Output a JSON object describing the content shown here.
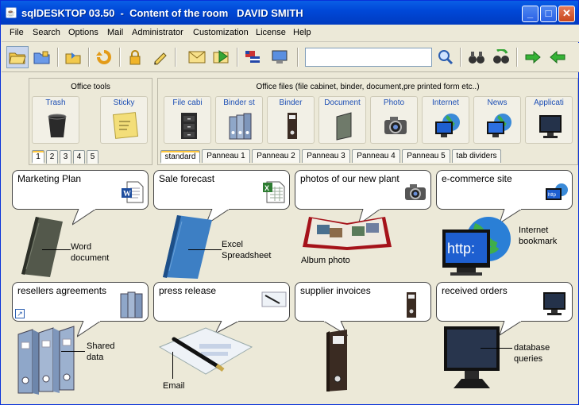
{
  "window": {
    "title": "sqlDESKTOP 03.50  -  Content of the room   DAVID SMITH",
    "min_glyph": "_",
    "max_glyph": "□",
    "close_glyph": "✕"
  },
  "menu": [
    "File",
    "Search",
    "Options",
    "Mail",
    "Administrator",
    "Customization",
    "License",
    "Help"
  ],
  "search": {
    "value": ""
  },
  "office_tools": {
    "title": "Office tools",
    "items": [
      {
        "label": "Trash",
        "icon": "trash-icon"
      },
      {
        "label": "Sticky",
        "icon": "sticky-note-icon"
      }
    ],
    "pages": [
      "1",
      "2",
      "3",
      "4",
      "5"
    ],
    "selected_page": "1"
  },
  "office_files": {
    "title": "Office files (file cabinet, binder, document,pre printed form etc..)",
    "items": [
      {
        "label": "File cabi",
        "icon": "file-cabinet-icon"
      },
      {
        "label": "Binder st",
        "icon": "binder-stack-icon"
      },
      {
        "label": "Binder",
        "icon": "binder-icon"
      },
      {
        "label": "Document",
        "icon": "document-icon"
      },
      {
        "label": "Photo",
        "icon": "camera-icon"
      },
      {
        "label": "Internet",
        "icon": "internet-icon"
      },
      {
        "label": "News",
        "icon": "news-icon"
      },
      {
        "label": "Applicati",
        "icon": "monitor-icon"
      }
    ],
    "tabs": [
      "standard",
      "Panneau 1",
      "Panneau 2",
      "Panneau 3",
      "Panneau 4",
      "Panneau 5",
      "tab dividers"
    ],
    "selected_tab": "standard"
  },
  "cards": [
    {
      "title": "Marketing Plan",
      "caption": "Word\ndocument",
      "icon": "word-doc-icon"
    },
    {
      "title": "Sale forecast",
      "caption": "Excel\nSpreadsheet",
      "icon": "excel-sheet-icon"
    },
    {
      "title": "photos of our new plant",
      "caption": "Album photo",
      "icon": "camera-icon"
    },
    {
      "title": "e-commerce site",
      "caption": "Internet\nbookmark",
      "icon": "http-monitor-icon"
    },
    {
      "title": "resellers agreements",
      "caption": "Shared\ndata",
      "icon": "binders-icon"
    },
    {
      "title": "press release",
      "caption": "Email",
      "icon": "envelope-pen-icon"
    },
    {
      "title": "supplier invoices",
      "caption": "",
      "icon": "binder-icon"
    },
    {
      "title": "received orders",
      "caption": "database\nqueries",
      "icon": "monitor-icon"
    }
  ],
  "colors": {
    "titlebar": "#0054E3",
    "window_bg": "#ECE9D8",
    "link_label": "#1D4FB5"
  }
}
